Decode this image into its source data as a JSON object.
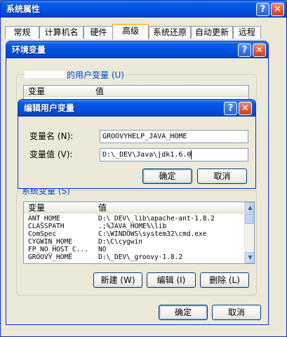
{
  "system_properties": {
    "title": "系统属性",
    "help_glyph": "?",
    "close_glyph": "✕",
    "tabs": [
      {
        "label": "常规"
      },
      {
        "label": "计算机名"
      },
      {
        "label": "硬件"
      },
      {
        "label": "高级"
      },
      {
        "label": "系统还原"
      },
      {
        "label": "自动更新"
      },
      {
        "label": "远程"
      }
    ],
    "active_tab": "高级"
  },
  "env_vars": {
    "title": "环境变量",
    "user_group_label": "的用户变量 (U)",
    "user_list_headers": {
      "name": "变量",
      "value": "值"
    },
    "system_group_label": "系统变量 (S)",
    "system_list_headers": {
      "name": "变量",
      "value": "值"
    },
    "system_vars": [
      {
        "name": "ANT_HOME",
        "value": "D:\\_DEV\\_lib\\apache-ant-1.8.2"
      },
      {
        "name": "CLASSPATH",
        "value": ".;%JAVA_HOME%\\lib"
      },
      {
        "name": "ComSpec",
        "value": "C:\\WINDOWS\\system32\\cmd.exe"
      },
      {
        "name": "CYGWIN_HOME",
        "value": "D:\\C\\cygwin"
      },
      {
        "name": "FP_NO_HOST_C...",
        "value": "NO"
      },
      {
        "name": "GROOVY_HOME",
        "value": "D:\\_DEV\\_groovy-1.8.2"
      }
    ],
    "buttons": {
      "new": "新建 (W)",
      "edit": "编辑 (I)",
      "delete": "删除 (L)"
    },
    "ok": "确定",
    "cancel": "取消"
  },
  "edit_dialog": {
    "title": "编辑用户变量",
    "name_label": "变量名 (N):",
    "value_label": "变量值 (V):",
    "name_value": "GROOVYHELP_JAVA_HOME",
    "value_value": "D:\\_DEV\\Java\\jdk1.6.0",
    "ok": "确定",
    "cancel": "取消"
  },
  "colors": {
    "titlebar": "#0054e3",
    "dialog_bg": "#ece9d8",
    "group_label": "#0046d5"
  }
}
